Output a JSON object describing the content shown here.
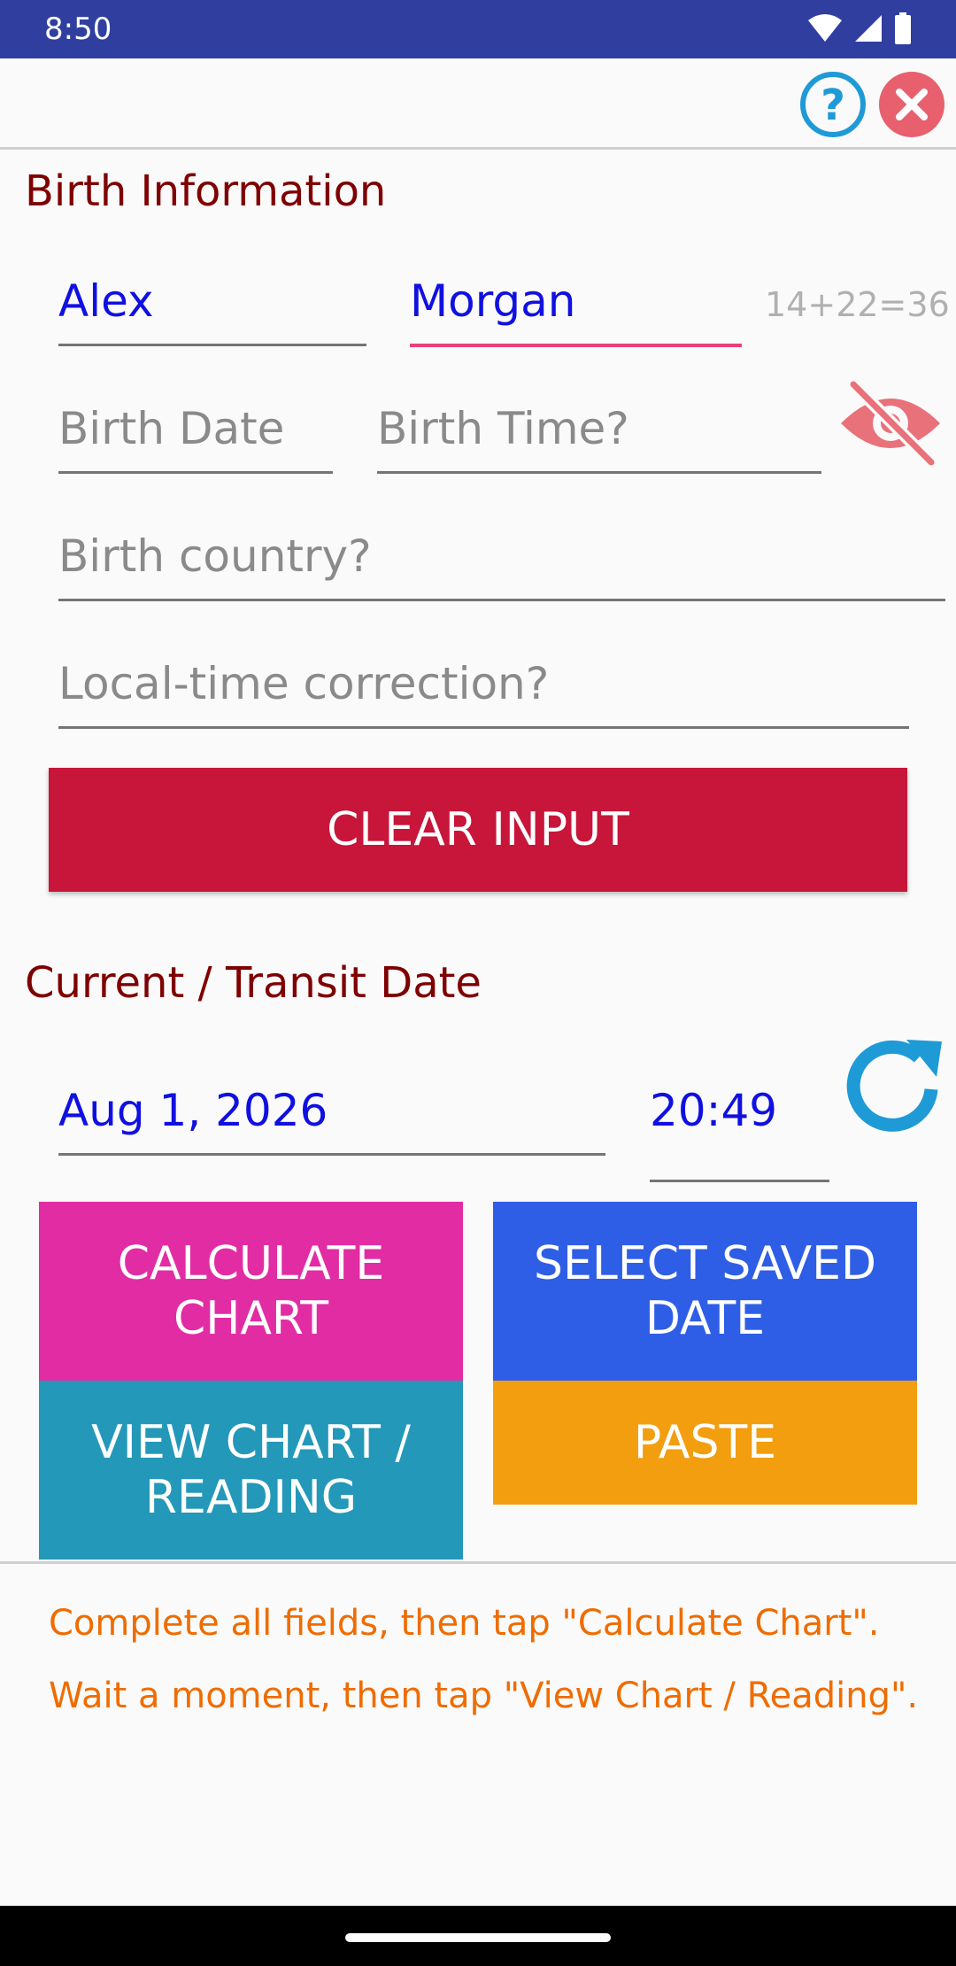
{
  "status": {
    "time": "8:50"
  },
  "toolbar": {
    "help_icon": "help-circle-icon",
    "close_icon": "close-circle-icon"
  },
  "birth": {
    "section_title": "Birth Information",
    "first_name": "Alex",
    "last_name": "Morgan",
    "name_count": "14+22=36",
    "birth_date_placeholder": "Birth Date",
    "birth_time_placeholder": "Birth Time?",
    "country_placeholder": "Birth country?",
    "correction_placeholder": "Local-time correction?",
    "clear_label": "CLEAR INPUT"
  },
  "transit": {
    "section_title": "Current / Transit Date",
    "date": "Aug 1, 2026",
    "time": "20:49"
  },
  "actions": {
    "calculate_line1": "CALCULATE",
    "calculate_line2": "CHART",
    "select_line1": "SELECT SAVED",
    "select_line2": "DATE",
    "view_line1": "VIEW CHART /",
    "view_line2": "READING",
    "paste_label": "PASTE"
  },
  "hints": {
    "line1": "Complete all fields, then tap \"Calculate Chart\".",
    "line2": "Wait a moment, then tap \"View Chart / Reading\"."
  },
  "colors": {
    "accent_title": "#7f0000",
    "input_value": "#1010e0",
    "clear_button": "#c8153a",
    "calculate_button": "#e22ca4",
    "select_button": "#2f5ee6",
    "view_button": "#2398b9",
    "paste_button": "#f29e0f",
    "hint_text": "#ef6c00"
  }
}
